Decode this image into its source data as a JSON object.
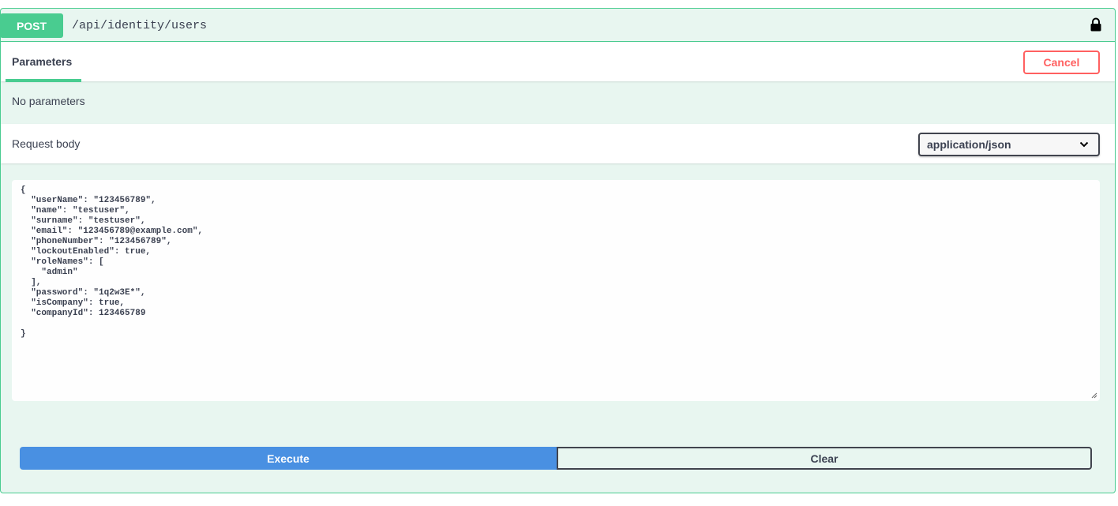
{
  "operation": {
    "method": "POST",
    "path": "/api/identity/users",
    "accent_color": "#49cc90"
  },
  "parameters": {
    "tab_label": "Parameters",
    "cancel_label": "Cancel",
    "empty_text": "No parameters"
  },
  "request_body": {
    "label": "Request body",
    "content_type": "application/json",
    "json_text": "{\n  \"userName\": \"123456789\",\n  \"name\": \"testuser\",\n  \"surname\": \"testuser\",\n  \"email\": \"123456789@example.com\",\n  \"phoneNumber\": \"123456789\",\n  \"lockoutEnabled\": true,\n  \"roleNames\": [\n    \"admin\"\n  ],\n  \"password\": \"1q2w3E*\",\n  \"isCompany\": true,\n  \"companyId\": 123465789\n\n}"
  },
  "actions": {
    "execute_label": "Execute",
    "clear_label": "Clear",
    "execute_color": "#4990e2"
  },
  "icons": {
    "lock": "lock-icon",
    "dropdown": "chevron-down-icon"
  }
}
